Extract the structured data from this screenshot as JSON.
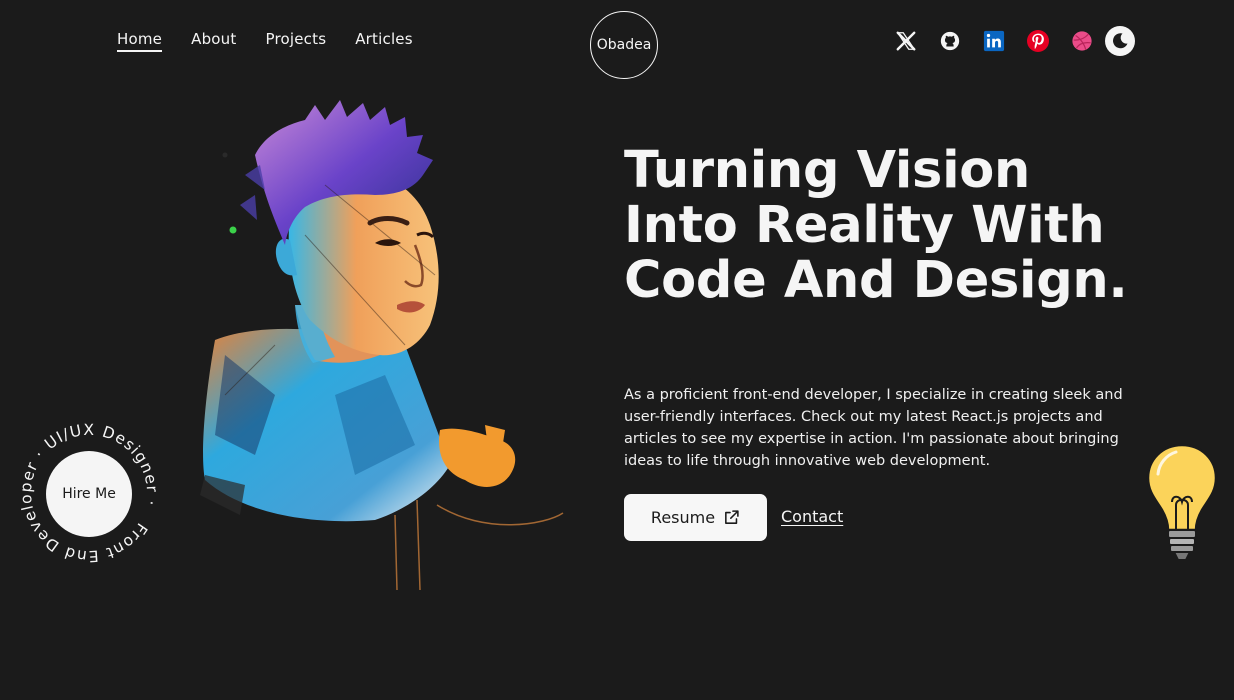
{
  "nav": {
    "items": [
      {
        "label": "Home",
        "active": true
      },
      {
        "label": "About"
      },
      {
        "label": "Projects"
      },
      {
        "label": "Articles"
      }
    ]
  },
  "logo": {
    "text": "Obadea"
  },
  "socials": [
    "x-icon",
    "github-icon",
    "linkedin-icon",
    "pinterest-icon",
    "dribbble-icon",
    "moon-icon"
  ],
  "hero": {
    "title": "Turning Vision Into Reality With Code And Design.",
    "description": "As a proficient front-end developer, I specialize in creating sleek and user-friendly interfaces. Check out my latest React.js projects and articles to see my expertise in action. I'm passionate about bringing ideas to life through innovative web development.",
    "resume_label": "Resume",
    "contact_label": "Contact"
  },
  "badge": {
    "ring_text": "Front End Developer · UI/UX Designer · ",
    "button_label": "Hire Me"
  },
  "colors": {
    "background": "#1b1b1b",
    "foreground": "#f5f5f5",
    "linkedin": "#0a66c2",
    "pinterest": "#e60023",
    "dribbble": "#ea4c89"
  }
}
